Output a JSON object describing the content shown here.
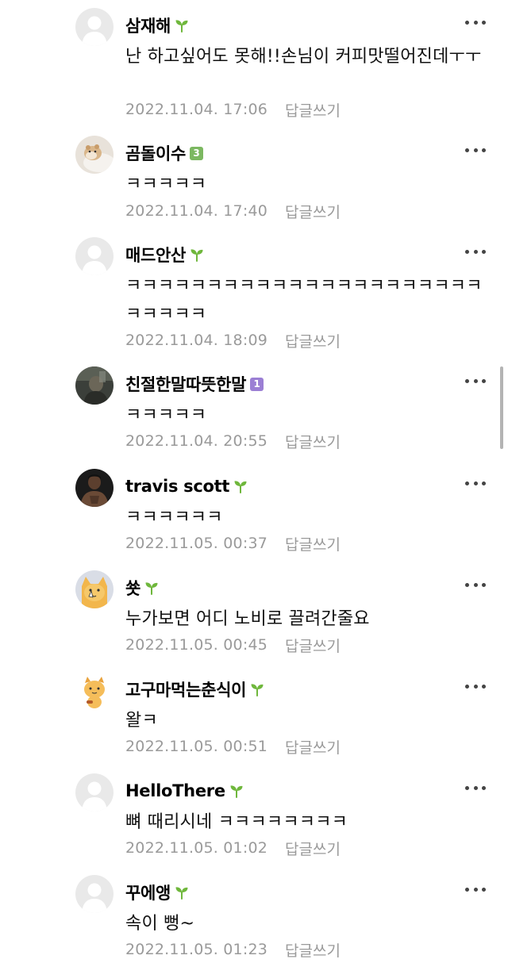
{
  "colors": {
    "sprout_badge": "#6fb73c",
    "level_badge_green": "#7cb861",
    "level_badge_purple": "#9b7fd4",
    "muted_text": "#9a9a9a"
  },
  "comments": [
    {
      "nickname": "삼재해",
      "badge": "sprout-icon",
      "body": "난 하고싶어도 못해!!손님이 커피맛떨어진데ㅜㅜ",
      "date": "2022.11.04. 17:06",
      "reply": "답글쓰기"
    },
    {
      "nickname": "곰돌이수",
      "badge": "level-3-badge",
      "badge_text": "3",
      "body": "ㅋㅋㅋㅋㅋ",
      "date": "2022.11.04. 17:40",
      "reply": "답글쓰기"
    },
    {
      "nickname": "매드안산",
      "badge": "sprout-icon",
      "body": "ㅋㅋㅋㅋㅋㅋㅋㅋㅋㅋㅋㅋㅋㅋㅋㅋㅋㅋㅋㅋㅋㅋㅋㅋㅋㅋㅋ",
      "date": "2022.11.04. 18:09",
      "reply": "답글쓰기"
    },
    {
      "nickname": "친절한말따뜻한말",
      "badge": "level-1-badge",
      "badge_text": "1",
      "body": "ㅋㅋㅋㅋㅋ",
      "date": "2022.11.04. 20:55",
      "reply": "답글쓰기"
    },
    {
      "nickname": "travis scott",
      "badge": "sprout-icon",
      "body": "ㅋㅋㅋㅋㅋㅋ",
      "date": "2022.11.05. 00:37",
      "reply": "답글쓰기"
    },
    {
      "nickname": "쑛",
      "badge": "sprout-icon",
      "body": "누가보면 어디 노비로 끌려간줄요",
      "date": "2022.11.05. 00:45",
      "reply": "답글쓰기"
    },
    {
      "nickname": "고구마먹는춘식이",
      "badge": "sprout-icon",
      "body": "왈ㅋ",
      "date": "2022.11.05. 00:51",
      "reply": "답글쓰기"
    },
    {
      "nickname": "HelloThere",
      "badge": "sprout-icon",
      "body": "뼈 때리시네 ㅋㅋㅋㅋㅋㅋㅋㅋ",
      "date": "2022.11.05. 01:02",
      "reply": "답글쓰기"
    },
    {
      "nickname": "꾸에앵",
      "badge": "sprout-icon",
      "body": "속이 뻥~",
      "date": "2022.11.05. 01:23",
      "reply": "답글쓰기"
    }
  ]
}
